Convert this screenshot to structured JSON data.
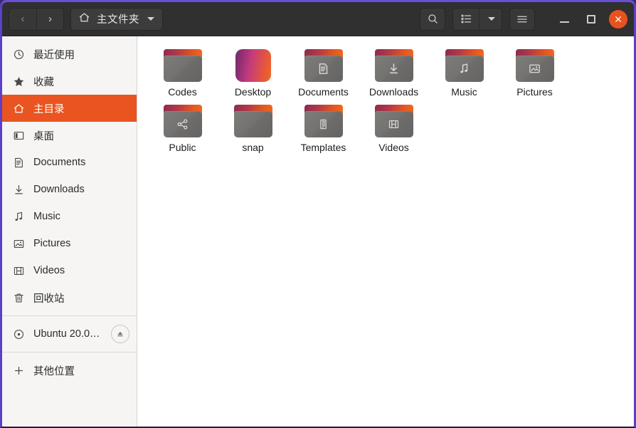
{
  "window": {
    "title": "主文件夹",
    "accent_color": "#e95420",
    "headerbar_color": "#303030",
    "sidebar_color": "#f6f5f4",
    "focus_border_color": "#5b40c9"
  },
  "header": {
    "nav": {
      "back_label": "‹",
      "back_name": "back-button",
      "forward_label": "›",
      "forward_name": "forward-button"
    },
    "path_button": {
      "icon": "home-icon",
      "label": "主文件夹",
      "caret": "chevron-down-icon"
    },
    "actions": [
      {
        "name": "search-button",
        "icon": "search-icon"
      },
      {
        "name": "view-list-button",
        "icon": "list-view-icon"
      },
      {
        "name": "view-options-button",
        "icon": "chevron-down-icon"
      },
      {
        "name": "main-menu-button",
        "icon": "hamburger-menu-icon"
      }
    ],
    "window_controls": {
      "minimize": "minimize-icon",
      "maximize": "maximize-icon",
      "close": "close-icon",
      "close_color": "#e8521f"
    }
  },
  "sidebar": {
    "groups": [
      {
        "items": [
          {
            "label": "最近使用",
            "icon": "recent-clock-icon",
            "selected": false,
            "name": "sidebar-item-recent"
          },
          {
            "label": "收藏",
            "icon": "star-icon",
            "selected": false,
            "name": "sidebar-item-starred"
          },
          {
            "label": "主目录",
            "icon": "home-icon",
            "selected": true,
            "name": "sidebar-item-home"
          },
          {
            "label": "桌面",
            "icon": "desktop-icon",
            "selected": false,
            "name": "sidebar-item-desktop"
          },
          {
            "label": "Documents",
            "icon": "documents-icon",
            "selected": false,
            "name": "sidebar-item-documents"
          },
          {
            "label": "Downloads",
            "icon": "downloads-icon",
            "selected": false,
            "name": "sidebar-item-downloads"
          },
          {
            "label": "Music",
            "icon": "music-note-icon",
            "selected": false,
            "name": "sidebar-item-music"
          },
          {
            "label": "Pictures",
            "icon": "picture-icon",
            "selected": false,
            "name": "sidebar-item-pictures"
          },
          {
            "label": "Videos",
            "icon": "video-film-icon",
            "selected": false,
            "name": "sidebar-item-videos"
          },
          {
            "label": "回收站",
            "icon": "trash-icon",
            "selected": false,
            "name": "sidebar-item-trash"
          }
        ]
      },
      {
        "items": [
          {
            "label": "Ubuntu 20.0…",
            "icon": "disc-icon",
            "selected": false,
            "name": "sidebar-item-ubuntu-disc",
            "eject": true,
            "eject_icon": "eject-icon"
          }
        ]
      },
      {
        "items": [
          {
            "label": "其他位置",
            "icon": "plus-icon",
            "selected": false,
            "name": "sidebar-item-other-locations"
          }
        ]
      }
    ]
  },
  "content": {
    "files": [
      {
        "label": "Codes",
        "kind": "folder",
        "emblem": "none"
      },
      {
        "label": "Desktop",
        "kind": "gradient-tile",
        "emblem": "none"
      },
      {
        "label": "Documents",
        "kind": "folder",
        "emblem": "document-icon"
      },
      {
        "label": "Downloads",
        "kind": "folder",
        "emblem": "download-arrow-icon"
      },
      {
        "label": "Music",
        "kind": "folder",
        "emblem": "music-note-icon"
      },
      {
        "label": "Pictures",
        "kind": "folder",
        "emblem": "picture-icon"
      },
      {
        "label": "Public",
        "kind": "folder",
        "emblem": "share-icon"
      },
      {
        "label": "snap",
        "kind": "folder",
        "emblem": "none"
      },
      {
        "label": "Templates",
        "kind": "folder",
        "emblem": "template-icon"
      },
      {
        "label": "Videos",
        "kind": "folder",
        "emblem": "video-film-icon"
      }
    ]
  }
}
